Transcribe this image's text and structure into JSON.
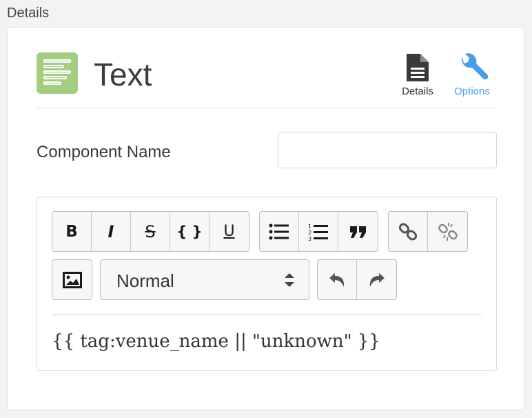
{
  "section": {
    "title": "Details"
  },
  "component": {
    "title": "Text",
    "icon": "text-lines-icon",
    "accent_color": "#a5cd82"
  },
  "tabs": [
    {
      "label": "Details",
      "icon": "document-icon",
      "color": "#333333"
    },
    {
      "label": "Options",
      "icon": "wrench-icon",
      "color": "#4a9ee9",
      "active": true
    }
  ],
  "form": {
    "component_name_label": "Component Name",
    "component_name_value": "",
    "component_name_placeholder": ""
  },
  "toolbar": {
    "bold": "B",
    "italic": "I",
    "strike": "S",
    "code": "{ }",
    "underline": "U",
    "block_format": {
      "selected": "Normal"
    }
  },
  "editor": {
    "content": "{{ tag:venue_name || \"unknown\" }}"
  }
}
